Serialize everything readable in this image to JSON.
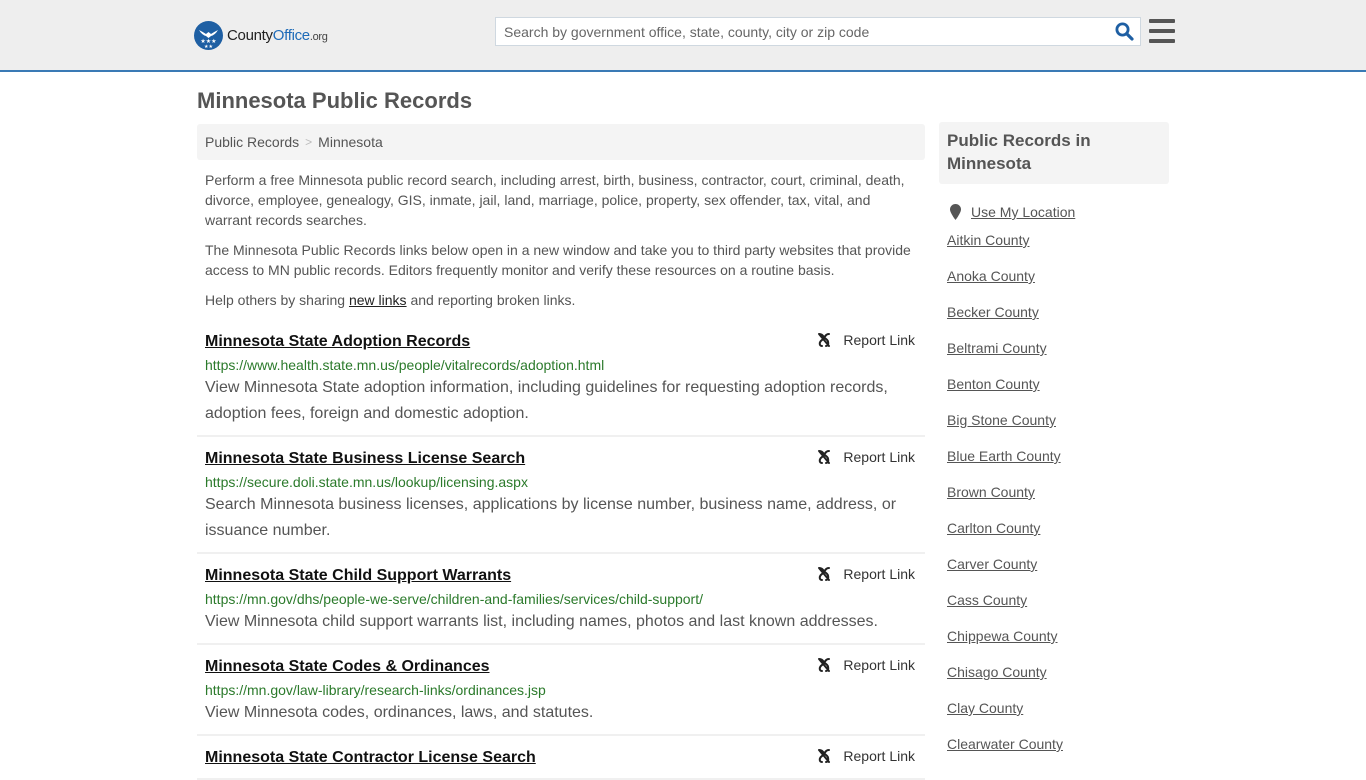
{
  "header": {
    "logo": {
      "name_part1": "County",
      "name_part2": "Office",
      "name_suffix": ".org"
    },
    "search": {
      "placeholder": "Search by government office, state, county, city or zip code",
      "value": ""
    },
    "accent_color": "#1e6bb8",
    "border_color": "#3a7ab5"
  },
  "page": {
    "title": "Minnesota Public Records"
  },
  "breadcrumb": {
    "items": [
      {
        "label": "Public Records"
      },
      {
        "label": "Minnesota"
      }
    ],
    "separator": ">"
  },
  "intro": {
    "p1": "Perform a free Minnesota public record search, including arrest, birth, business, contractor, court, criminal, death, divorce, employee, genealogy, GIS, inmate, jail, land, marriage, police, property, sex offender, tax, vital, and warrant records searches.",
    "p2": "The Minnesota Public Records links below open in a new window and take you to third party websites that provide access to MN public records. Editors frequently monitor and verify these resources on a routine basis.",
    "p3_before": "Help others by sharing ",
    "p3_link": "new links",
    "p3_after": " and reporting broken links."
  },
  "records": [
    {
      "title": "Minnesota State Adoption Records",
      "url": "https://www.health.state.mn.us/people/vitalrecords/adoption.html",
      "description": "View Minnesota State adoption information, including guidelines for requesting adoption records, adoption fees, foreign and domestic adoption.",
      "report_label": "Report Link"
    },
    {
      "title": "Minnesota State Business License Search",
      "url": "https://secure.doli.state.mn.us/lookup/licensing.aspx",
      "description": "Search Minnesota business licenses, applications by license number, business name, address, or issuance number.",
      "report_label": "Report Link"
    },
    {
      "title": "Minnesota State Child Support Warrants",
      "url": "https://mn.gov/dhs/people-we-serve/children-and-families/services/child-support/",
      "description": "View Minnesota child support warrants list, including names, photos and last known addresses.",
      "report_label": "Report Link"
    },
    {
      "title": "Minnesota State Codes & Ordinances",
      "url": "https://mn.gov/law-library/research-links/ordinances.jsp",
      "description": "View Minnesota codes, ordinances, laws, and statutes.",
      "report_label": "Report Link"
    },
    {
      "title": "Minnesota State Contractor License Search",
      "url": "",
      "description": "",
      "report_label": "Report Link"
    }
  ],
  "sidebar": {
    "heading": "Public Records in Minnesota",
    "use_location": "Use My Location",
    "counties": [
      "Aitkin County",
      "Anoka County",
      "Becker County",
      "Beltrami County",
      "Benton County",
      "Big Stone County",
      "Blue Earth County",
      "Brown County",
      "Carlton County",
      "Carver County",
      "Cass County",
      "Chippewa County",
      "Chisago County",
      "Clay County",
      "Clearwater County"
    ]
  }
}
